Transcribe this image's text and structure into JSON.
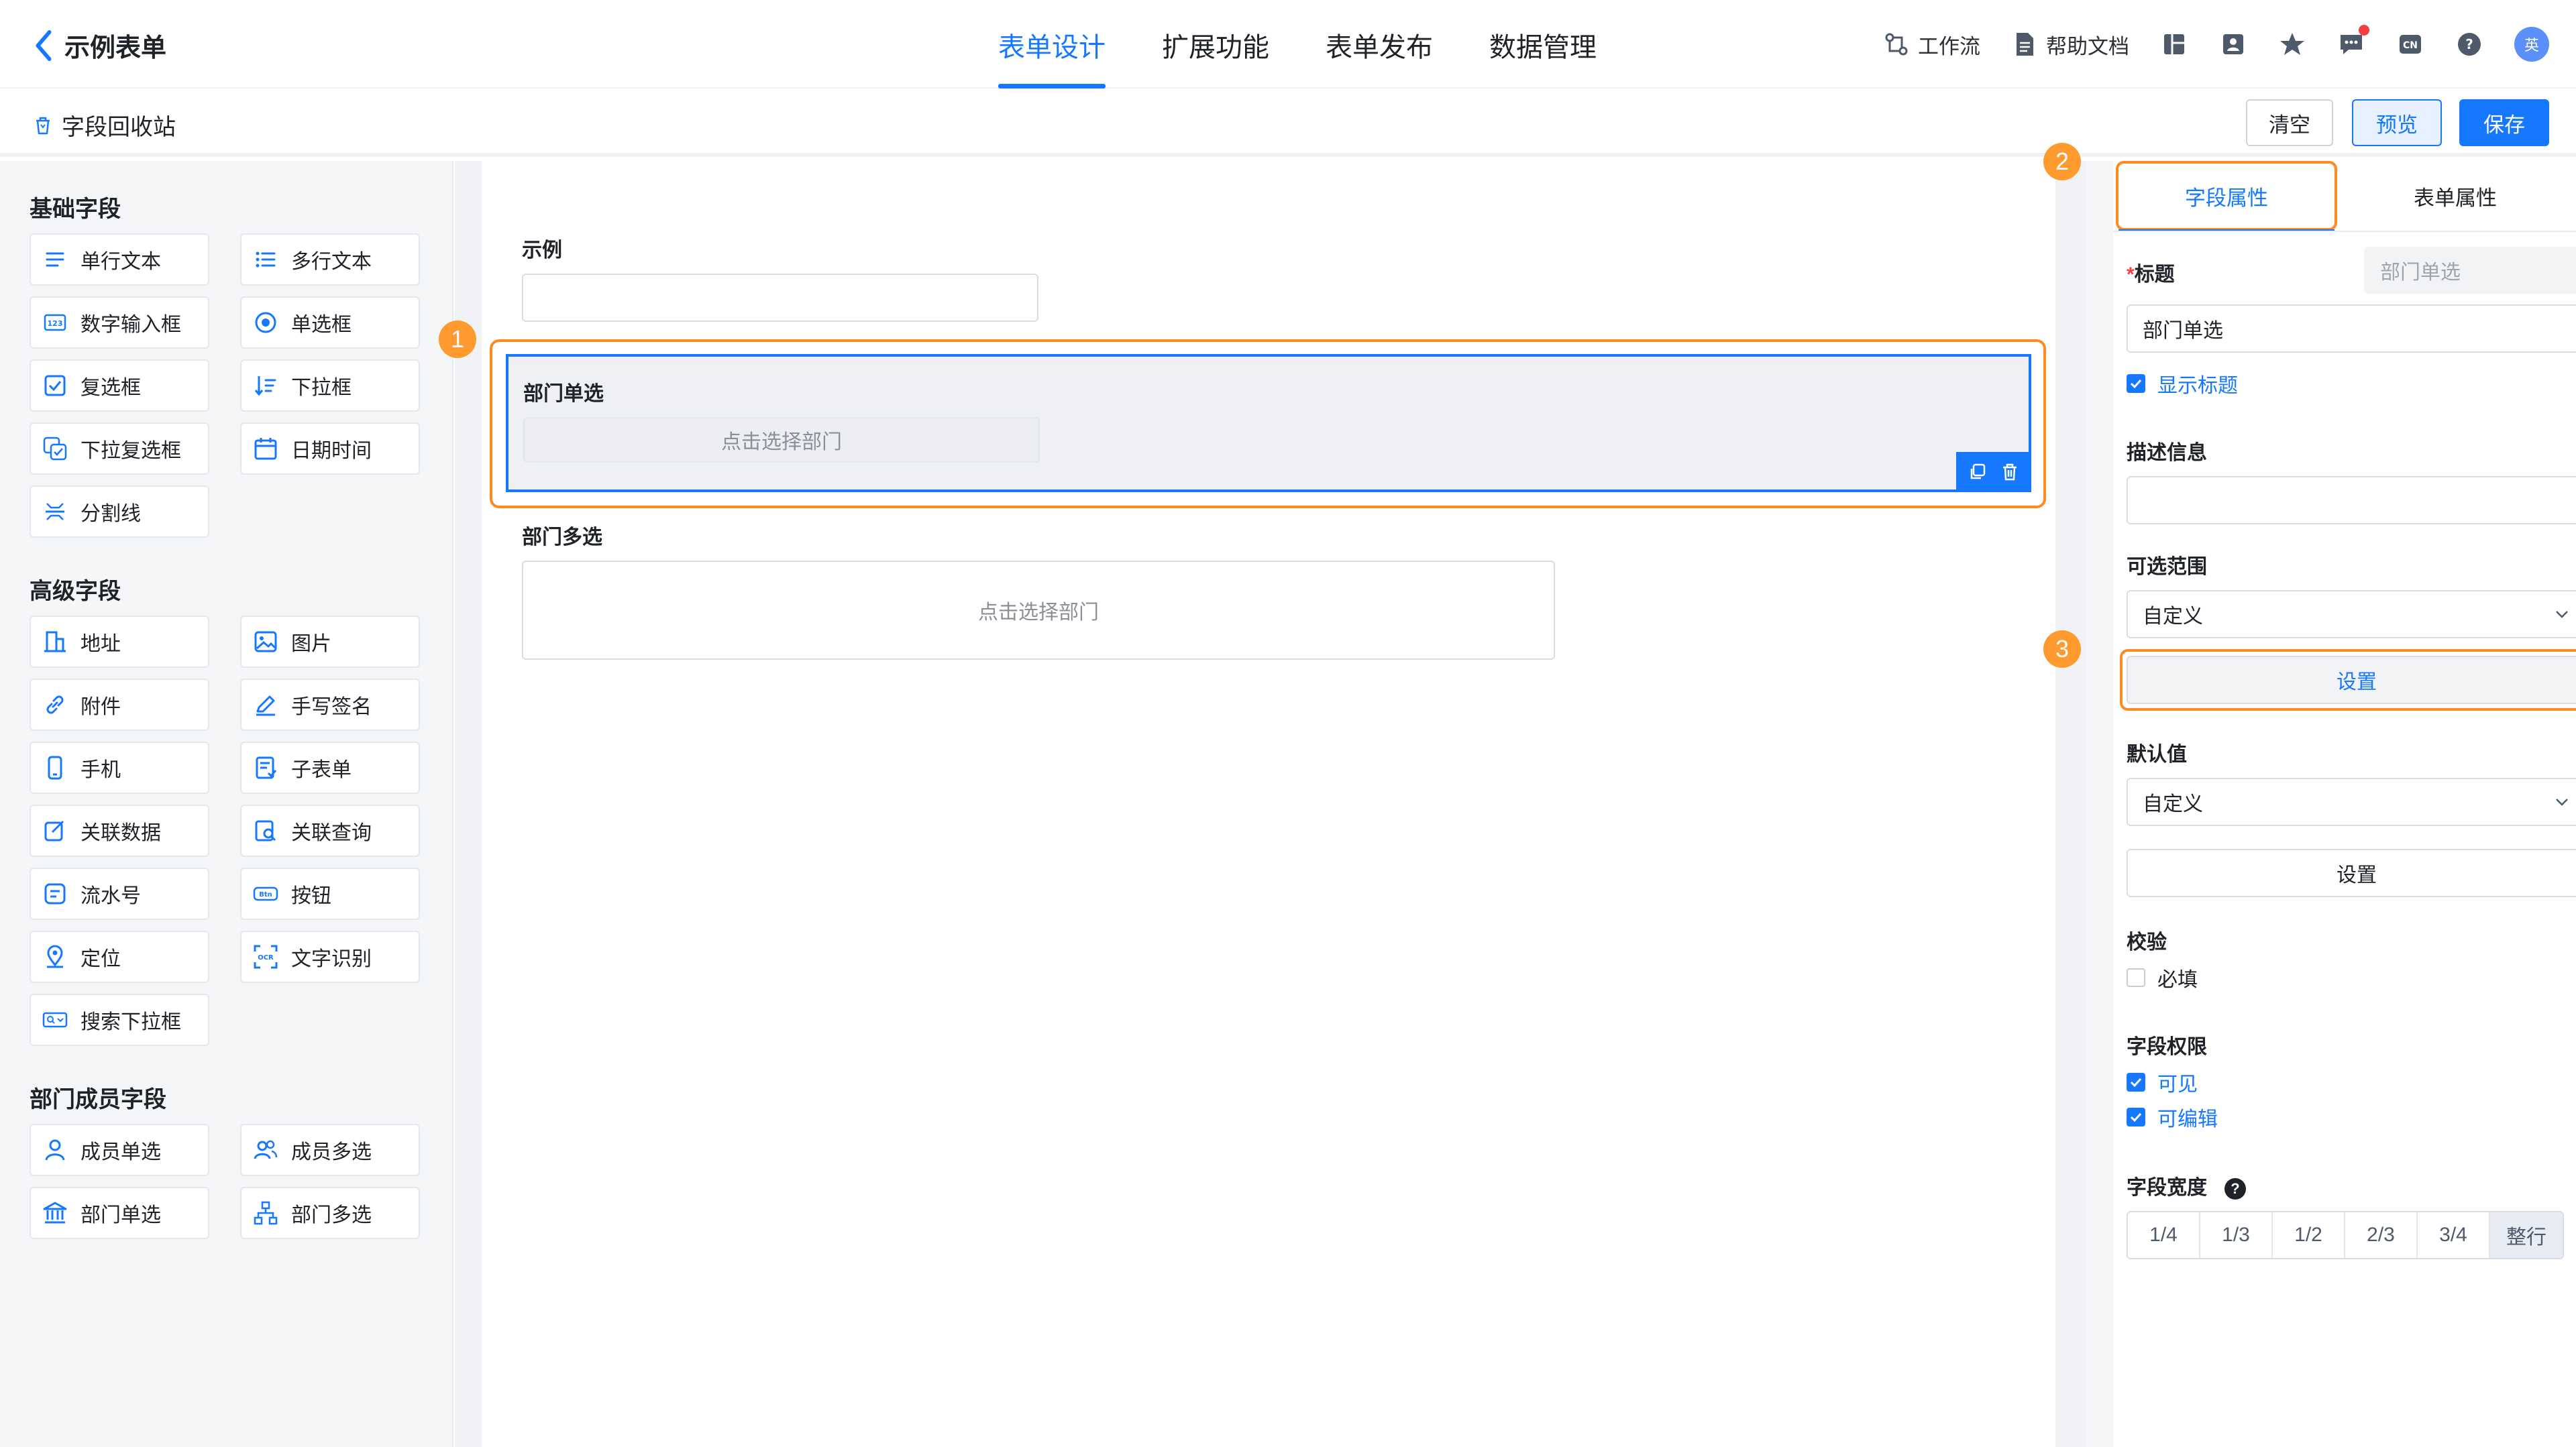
{
  "header": {
    "back_title": "示例表单",
    "tabs": [
      {
        "label": "表单设计",
        "active": true
      },
      {
        "label": "扩展功能",
        "active": false
      },
      {
        "label": "表单发布",
        "active": false
      },
      {
        "label": "数据管理",
        "active": false
      }
    ],
    "tools": {
      "workflow": "工作流",
      "help_docs": "帮助文档"
    },
    "avatar_text": "英",
    "accent_color": "#1677ff"
  },
  "subbar": {
    "recycle_label": "字段回收站",
    "clear_label": "清空",
    "preview_label": "预览",
    "save_label": "保存"
  },
  "left_panel": {
    "groups": [
      {
        "title": "基础字段",
        "items": [
          "单行文本",
          "多行文本",
          "数字输入框",
          "单选框",
          "复选框",
          "下拉框",
          "下拉复选框",
          "日期时间",
          "分割线"
        ]
      },
      {
        "title": "高级字段",
        "items": [
          "地址",
          "图片",
          "附件",
          "手写签名",
          "手机",
          "子表单",
          "关联数据",
          "关联查询",
          "流水号",
          "按钮",
          "定位",
          "文字识别",
          "搜索下拉框"
        ]
      },
      {
        "title": "部门成员字段",
        "items": [
          "成员单选",
          "成员多选",
          "部门单选",
          "部门多选"
        ]
      }
    ]
  },
  "canvas": {
    "example_label": "示例",
    "dept_single_label": "部门单选",
    "dept_single_placeholder": "点击选择部门",
    "dept_multi_label": "部门多选",
    "dept_multi_placeholder": "点击选择部门"
  },
  "badges": [
    "1",
    "2",
    "3"
  ],
  "highlight_color": "#ff8a1f",
  "right_panel": {
    "tab_field": "字段属性",
    "tab_form": "表单属性",
    "title_label": "标题",
    "title_required_mark": "*",
    "title_tag": "部门单选",
    "title_value": "部门单选",
    "show_title_label": "显示标题",
    "show_title_checked": true,
    "desc_label": "描述信息",
    "desc_value": "",
    "range_label": "可选范围",
    "range_value": "自定义",
    "range_button": "设置",
    "default_label": "默认值",
    "default_value": "自定义",
    "default_button": "设置",
    "validate_label": "校验",
    "required_label": "必填",
    "required_checked": false,
    "perm_label": "字段权限",
    "visible_label": "可见",
    "visible_checked": true,
    "editable_label": "可编辑",
    "editable_checked": true,
    "width_label": "字段宽度",
    "width_help": "?",
    "width_options": [
      "1/4",
      "1/3",
      "1/2",
      "2/3",
      "3/4",
      "整行"
    ],
    "width_selected": "整行"
  }
}
